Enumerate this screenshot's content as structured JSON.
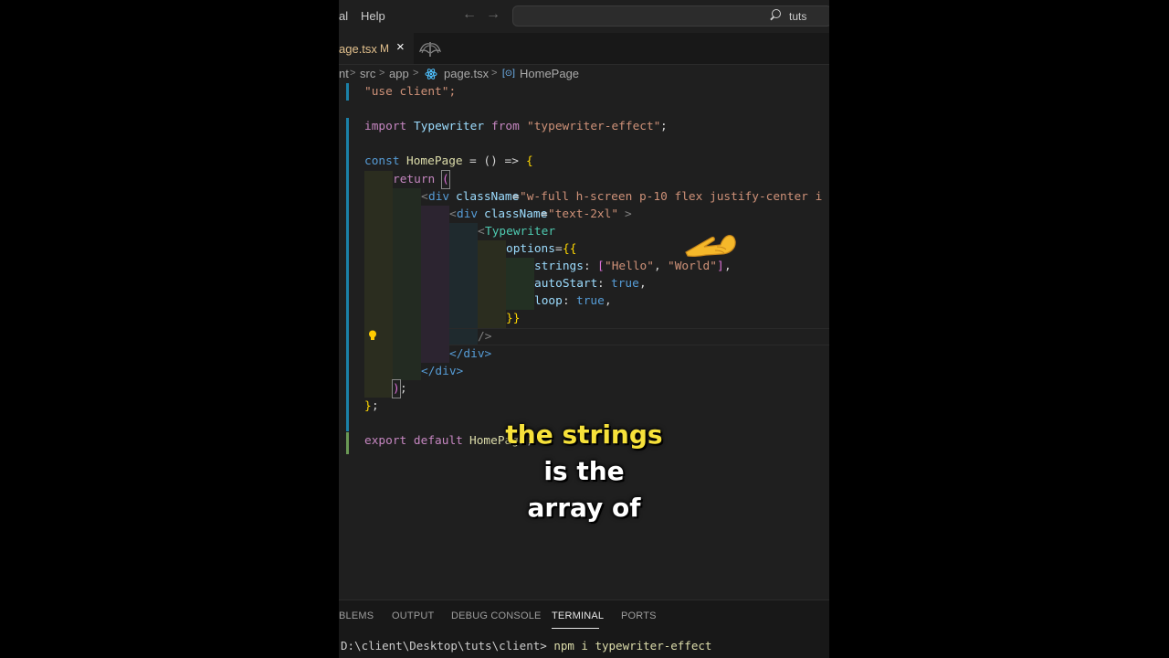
{
  "titlebar": {
    "menu_partial": "al",
    "menu_help": "Help",
    "back_arrow": "←",
    "forward_arrow": "→",
    "search_text": "tuts"
  },
  "tab": {
    "name": "age.tsx",
    "modified": "M",
    "close": "×"
  },
  "breadcrumb": {
    "items": [
      "nt",
      "src",
      "app",
      "page.tsx",
      "HomePage"
    ],
    "sep": ">",
    "symbol_icon": "[⊙]"
  },
  "code": {
    "l1": "\"use client\";",
    "l3_import": "import",
    "l3_name": "Typewriter",
    "l3_from": "from",
    "l3_module": "\"typewriter-effect\"",
    "l3_semi": ";",
    "l5_const": "const",
    "l5_name": "HomePage",
    "l5_rest": "= () =>",
    "l5_brace": "{",
    "l6_return": "return",
    "l6_paren": "(",
    "l7_open": "<",
    "l7_tag": "div",
    "l7_attr": "className",
    "l7_eq": "=",
    "l7_value": "\"w-full h-screen p-10 flex justify-center i",
    "l8_open": "<",
    "l8_tag": "div",
    "l8_attr": "className",
    "l8_eq": "=",
    "l8_value": "\"text-2xl\"",
    "l8_close": ">",
    "l9_open": "<",
    "l9_tag": "Typewriter",
    "l10_attr": "options",
    "l10_eq": "=",
    "l10_brace": "{{",
    "l11_key": "strings",
    "l11_colon": ":",
    "l11_bracket_open": "[",
    "l11_v1": "\"Hello\"",
    "l11_comma": ",",
    "l11_v2": "\"World\"",
    "l11_bracket_close": "]",
    "l11_end": ",",
    "l12_key": "autoStart",
    "l12_colon": ":",
    "l12_value": "true",
    "l12_end": ",",
    "l13_key": "loop",
    "l13_colon": ":",
    "l13_value": "true",
    "l13_end": ",",
    "l14_brace": "}}",
    "l15_selfclose": "/>",
    "l16_close": "</div>",
    "l17_close": "</div>",
    "l18_paren": ")",
    "l18_semi": ";",
    "l19_brace": "}",
    "l19_semi": ";",
    "l21_export": "export default",
    "l21_name": "HomePage",
    "l21_semi": ";"
  },
  "caption": {
    "line1": "the strings",
    "line2": "is the",
    "line3": "array of"
  },
  "panel": {
    "tabs": [
      "BLEMS",
      "OUTPUT",
      "DEBUG CONSOLE",
      "TERMINAL",
      "PORTS"
    ],
    "active_tab": "TERMINAL",
    "terminal_prompt": "D:\\client\\Desktop\\tuts\\client>",
    "terminal_command": "npm i typewriter-effect"
  },
  "colors": {
    "editor_bg": "#1f1f1f",
    "caption_highlight": "#f6e13a",
    "git_modified_bar": "#1b81a8"
  }
}
